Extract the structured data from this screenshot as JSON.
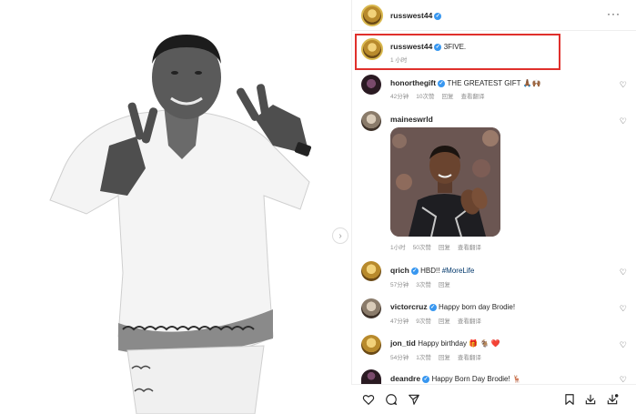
{
  "post": {
    "author": "russwest44",
    "caption": "3FIVE.",
    "time": "1 小时"
  },
  "comments": [
    {
      "user": "honorthegift",
      "text": "THE GREATEST GIFT 🙏🏾🙌🏾",
      "time": "42分钟",
      "likes": "10次赞",
      "reply": "回复",
      "translate": "查看翻译"
    },
    {
      "user": "maineswrld",
      "text": "",
      "time": "1小时",
      "likes": "50次赞",
      "reply": "回复",
      "translate": "查看翻译"
    },
    {
      "user": "qrich",
      "text": "HBD!! ",
      "hashtag": "#MoreLife",
      "time": "57分钟",
      "likes": "3次赞",
      "reply": "回复"
    },
    {
      "user": "victorcruz",
      "text": "Happy born day Brodie!",
      "time": "47分钟",
      "likes": "9次赞",
      "reply": "回复",
      "translate": "查看翻译"
    },
    {
      "user": "jon_tid",
      "text": "Happy birthday 🎁 🐐 ❤️",
      "time": "54分钟",
      "likes": "1次赞",
      "reply": "回复",
      "translate": "查看翻译"
    },
    {
      "user": "deandre",
      "text": "Happy Born Day Brodie! 🦌"
    }
  ],
  "icons": {
    "more": "more-horizontal-icon",
    "like": "heart-icon",
    "comment": "comment-icon",
    "share": "share-icon",
    "save": "bookmark-icon",
    "download1": "download-icon",
    "download2": "download-icon"
  },
  "colors": {
    "highlight": "#e0302c",
    "verified": "#3897f0",
    "hashtag": "#00376b"
  }
}
